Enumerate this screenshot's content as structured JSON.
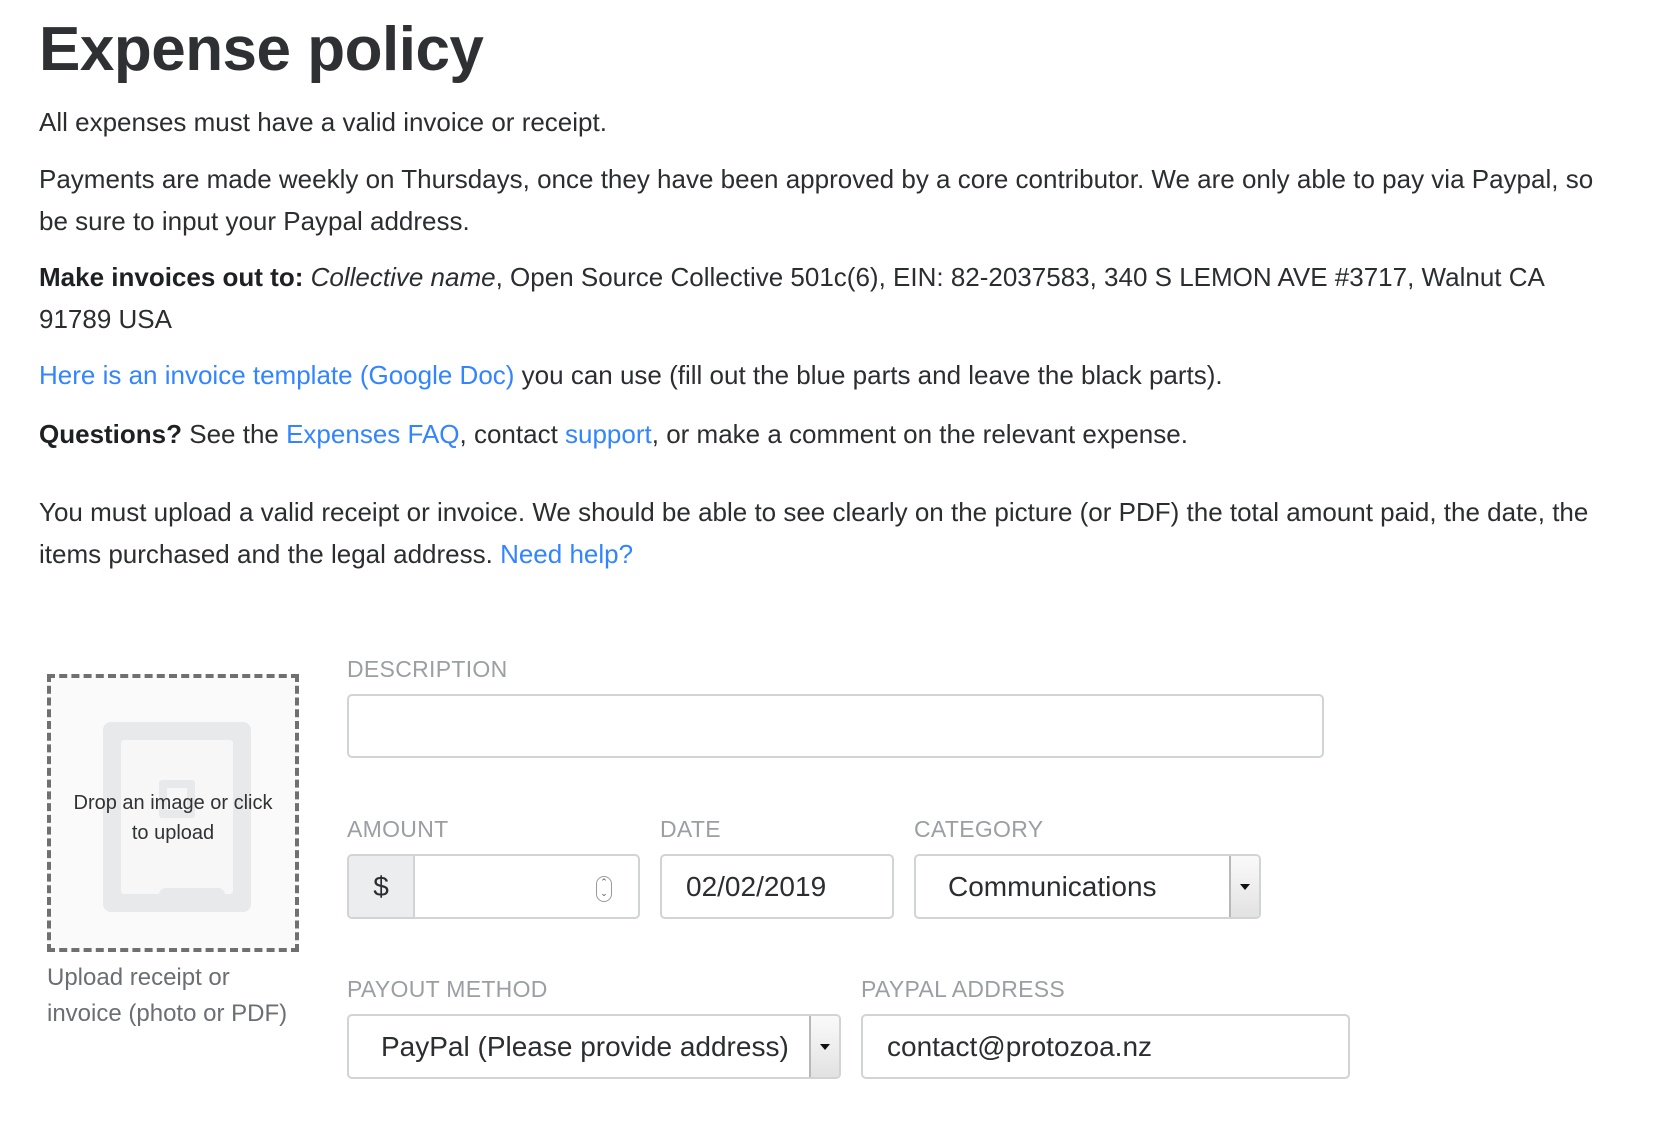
{
  "policy": {
    "title": "Expense policy",
    "p1": "All expenses must have a valid invoice or receipt.",
    "p2": "Payments are made weekly on Thursdays, once they have been approved by a core contributor. We are only able to pay via Paypal, so be sure to input your Paypal address.",
    "p3_bold": "Make invoices out to:",
    "p3_italic": "Collective name",
    "p3_rest": ", Open Source Collective 501c(6), EIN: 82-2037583, 340 S LEMON AVE #3717, Walnut CA 91789 USA",
    "p4_link": "Here is an invoice template (Google Doc)",
    "p4_rest": " you can use (fill out the blue parts and leave the black parts).",
    "p5_bold": "Questions?",
    "p5_a": " See the ",
    "p5_link1": "Expenses FAQ",
    "p5_b": ", contact ",
    "p5_link2": "support",
    "p5_c": ", or make a comment on the relevant expense."
  },
  "receipt_notice": {
    "text": "You must upload a valid receipt or invoice. We should be able to see clearly on the picture (or PDF) the total amount paid, the date, the items purchased and the legal address. ",
    "help_link": "Need help?"
  },
  "upload": {
    "drop_text": "Drop an image or click to upload",
    "caption": "Upload receipt or invoice (photo or PDF)"
  },
  "form": {
    "description_label": "DESCRIPTION",
    "description_value": "",
    "amount_label": "AMOUNT",
    "amount_prefix": "$",
    "amount_value": "",
    "date_label": "DATE",
    "date_value": "02/02/2019",
    "category_label": "CATEGORY",
    "category_value": "Communications",
    "payout_label": "PAYOUT METHOD",
    "payout_value": "PayPal (Please provide address)",
    "paypal_label": "PAYPAL ADDRESS",
    "paypal_value": "contact@protozoa.nz"
  },
  "icons": {
    "upload_placeholder": "document-placeholder-icon",
    "select_arrow": "chevron-down-icon",
    "spinner": "number-spinner-icon"
  },
  "colors": {
    "link": "#3385ff",
    "text": "#2b2d30",
    "label": "#9b9ea3",
    "border": "#d1d3d6"
  }
}
